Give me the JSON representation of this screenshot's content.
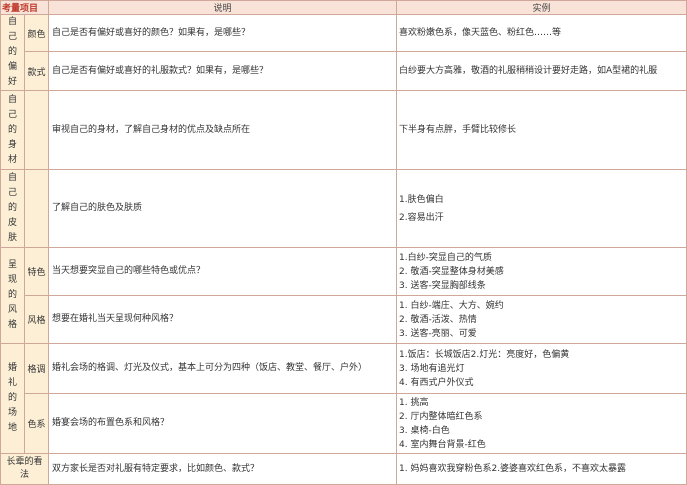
{
  "header": {
    "category": "考量项目",
    "description": "说明",
    "example": "实例"
  },
  "groups": [
    {
      "category": "自己的偏好",
      "rows": [
        {
          "sub": "颜色",
          "description": "自己是否有偏好或喜好的颜色？如果有，是哪些？",
          "examples": [
            "喜欢粉嫩色系，像天蓝色、粉红色……等"
          ]
        },
        {
          "sub": "款式",
          "description": "自己是否有偏好或喜好的礼服款式？如果有，是哪些？",
          "examples": [
            "白纱要大方高雅，敬酒的礼服稍稍设计要好走路，如A型裙的礼服"
          ]
        }
      ]
    },
    {
      "category": "自己的身材",
      "rows": [
        {
          "description": "审视自己的身材，了解自己身材的优点及缺点所在",
          "examples": [
            "下半身有点胖，手臂比较修长"
          ]
        }
      ]
    },
    {
      "category": "自己的皮肤",
      "rows": [
        {
          "description": "了解自己的肤色及肤质",
          "examples": [
            "1.肤色偏白",
            "2.容易出汗"
          ]
        }
      ]
    },
    {
      "category": "呈现的风格",
      "rows": [
        {
          "sub": "特色",
          "description": "当天想要突显自己的哪些特色或优点？",
          "examples": [
            "1.白纱-突显自己的气质",
            "2. 敬酒-突显整体身材美感",
            "3. 送客-突显胸部线条"
          ]
        },
        {
          "sub": "风格",
          "description": "想要在婚礼当天呈现何种风格？",
          "examples": [
            "1. 白纱-端庄、大方、婉约",
            "2. 敬酒-活泼、热情",
            "3. 送客-亮丽、可爱"
          ]
        }
      ]
    },
    {
      "category": "婚礼的场地",
      "rows": [
        {
          "sub": "格调",
          "description": "婚礼会场的格调、灯光及仪式，基本上可分为四种（饭店、教堂、餐厅、户外）",
          "examples": [
            "1.饭店：长城饭店2.灯光：亮度好，色偏黄",
            "3. 场地有追光灯",
            "4. 有西式户外仪式"
          ]
        },
        {
          "sub": "色系",
          "description": "婚宴会场的布置色系和风格？",
          "examples": [
            "1. 挑高",
            "2. 厅内整体暗红色系",
            "3. 桌椅-白色",
            "4. 室内舞台背景-红色"
          ]
        }
      ]
    },
    {
      "category": "长辈的看法",
      "rows": [
        {
          "description": "双方家长是否对礼服有特定要求，比如颜色、款式？",
          "examples": [
            "1. 妈妈喜欢我穿粉色系2.婆婆喜欢红色系，不喜欢太暴露"
          ]
        }
      ]
    }
  ]
}
